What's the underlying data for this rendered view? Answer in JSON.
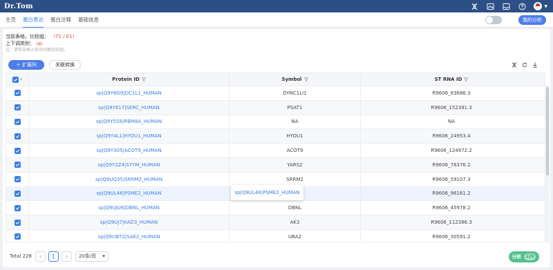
{
  "app": {
    "logo": "Dr.Tom"
  },
  "nav": {
    "tabs": [
      "主页",
      "蛋白表达",
      "蛋白注释",
      "基础信息"
    ],
    "active_index": 1,
    "my_analysis": "我的分析"
  },
  "info": {
    "current_table_label": "当前表格，比较组：",
    "current_table_value": "（T1 / E1）",
    "regulation_label": "上下调类别：",
    "regulation_value": "up",
    "note": "注：请单击图上各块切换比较组。"
  },
  "toolbar": {
    "expand_label": "扩展列",
    "convert_label": "关联转换"
  },
  "table": {
    "columns": [
      "Protein ID",
      "Symbol",
      "ST RNA ID"
    ],
    "rows": [
      {
        "protein_id": "sp|Q9Y6G9|DC1L1_HUMAN",
        "symbol": "DYNC1LI1",
        "st_rna_id": "R9606_83686.3"
      },
      {
        "protein_id": "sp|Q9Y617|SERC_HUMAN",
        "symbol": "PSAT1",
        "st_rna_id": "R9606_152391.3"
      },
      {
        "protein_id": "sp|Q9Y5S9|RBM8A_HUMAN",
        "symbol": "NA",
        "st_rna_id": "NA"
      },
      {
        "protein_id": "sp|Q9Y4L1|HYOU1_HUMAN",
        "symbol": "HYOU1",
        "st_rna_id": "R9606_24953.4"
      },
      {
        "protein_id": "sp|Q9Y305|ACOT9_HUMAN",
        "symbol": "ACOT9",
        "st_rna_id": "R9606_124972.2"
      },
      {
        "protein_id": "sp|Q9Y2Z4|SYYM_HUMAN",
        "symbol": "YARS2",
        "st_rna_id": "R9606_76376.2"
      },
      {
        "protein_id": "sp|Q9UQ35|SRRM2_HUMAN",
        "symbol": "SRRM2",
        "st_rna_id": "R9606_59107.3"
      },
      {
        "protein_id": "sp|Q9UL46|PSME2_HUMAN",
        "symbol": "PSME2",
        "st_rna_id": "R9606_96161.2"
      },
      {
        "protein_id": "sp|Q9UJU6|DBNL_HUMAN",
        "symbol": "DBNL",
        "st_rna_id": "R9606_45978.2"
      },
      {
        "protein_id": "sp|Q9UJ7|KAD3_HUMAN",
        "symbol": "AK3",
        "st_rna_id": "R9606_112386.3"
      },
      {
        "protein_id": "sp|Q9UBT2|SAE2_HUMAN",
        "symbol": "UBA2",
        "st_rna_id": "R9606_30591.2"
      }
    ]
  },
  "tooltip": {
    "text": "sp|Q9UL46|PSME2_HUMAN"
  },
  "pagination": {
    "total_label": "Total 228",
    "current_page": "1",
    "page_size": "20条/页"
  },
  "analyze": {
    "label": "分析",
    "count": "228"
  },
  "colors": {
    "topbar": "#2c4f85",
    "accent": "#3a7ee6",
    "button": "#4c7de8",
    "analyze": "#52c08a",
    "up": "#e04a3f"
  }
}
